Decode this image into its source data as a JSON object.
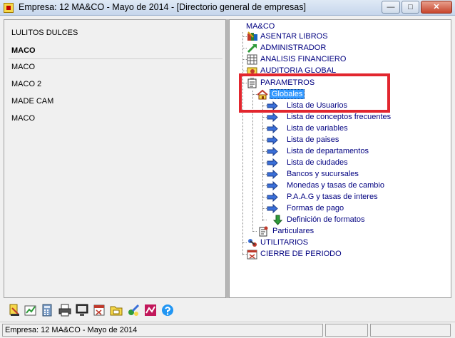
{
  "window": {
    "title": "Empresa: 12 MA&CO - Mayo de 2014 - [Directorio general de empresas]",
    "min_label": "—",
    "max_label": "□",
    "close_label": "✕"
  },
  "companies": [
    "LULITOS DULCES",
    "MACO",
    "MACO",
    "MACO 2",
    "MADE CAM",
    "MACO"
  ],
  "tree": {
    "root": "MA&CO",
    "items": [
      "ASENTAR LIBROS",
      "ADMINISTRADOR",
      "ANALISIS FINANCIERO",
      "AUDITORIA GLOBAL",
      "PARAMETROS",
      "Globales",
      "Lista de Usuarios",
      "Lista de conceptos frecuentes",
      "Lista de variables",
      "Lista de paises",
      "Lista de departamentos",
      "Lista de ciudades",
      "Bancos y sucursales",
      "Monedas y tasas de cambio",
      "P.A.A.G y tasas de interes",
      "Formas de pago",
      "Definición de formatos",
      "Particulares",
      "UTILITARIOS",
      "CIERRE DE PERIODO"
    ]
  },
  "toolbar": [
    "notes-icon",
    "chart-icon",
    "calculator-icon",
    "printer-icon",
    "monitor-icon",
    "calendar-icon",
    "folder-icon",
    "tools-icon",
    "trend-icon",
    "help-icon"
  ],
  "status": {
    "text": "Empresa: 12 MA&CO - Mayo de 2014"
  },
  "colors": {
    "highlight": "#e2262e",
    "tree_text": "#000080",
    "selection": "#3399ff"
  }
}
